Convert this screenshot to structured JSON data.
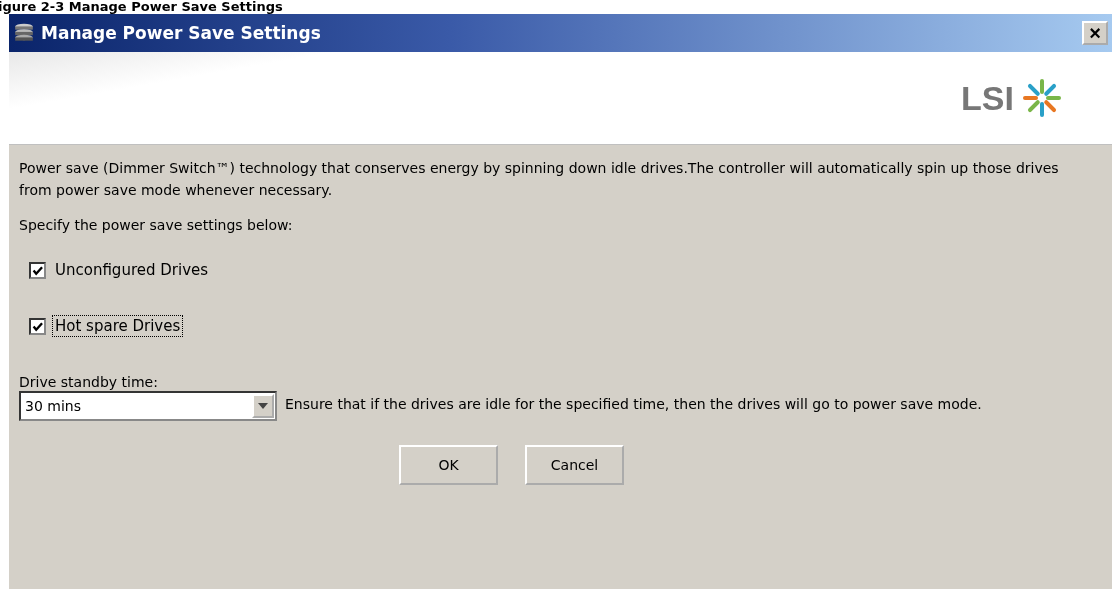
{
  "caption": "igure 2-3 Manage Power Save Settings",
  "window": {
    "title": "Manage Power Save Settings",
    "close": "×"
  },
  "banner": {
    "logo": "LSI"
  },
  "description": "Power save (Dimmer Switch™) technology that conserves energy by spinning down idle drives.The controller will automatically spin up those drives from power save mode whenever necessary.",
  "instruction": "Specify the power save settings below:",
  "options": [
    {
      "label": "Unconfigured Drives",
      "checked": true,
      "focused": false
    },
    {
      "label": "Hot spare Drives",
      "checked": true,
      "focused": true
    }
  ],
  "standby": {
    "label": "Drive standby time:",
    "value": "30 mins",
    "help": "Ensure that if the drives are idle for the specified time, then the drives will go to power save mode."
  },
  "buttons": [
    "OK",
    "Cancel"
  ]
}
